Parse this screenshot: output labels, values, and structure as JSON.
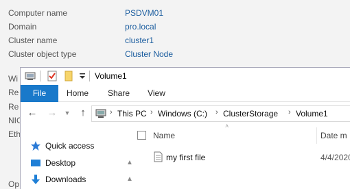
{
  "server_manager": {
    "properties": [
      {
        "label": "Computer name",
        "value": "PSDVM01"
      },
      {
        "label": "Domain",
        "value": "pro.local"
      },
      {
        "label": "Cluster name",
        "value": "cluster1"
      },
      {
        "label": "Cluster object type",
        "value": "Cluster Node"
      }
    ],
    "partial_labels": [
      "Wi",
      "Re",
      "Re",
      "NIC",
      "Eth",
      "Op"
    ]
  },
  "explorer": {
    "title": "Volume1",
    "ribbon_tabs": {
      "file": "File",
      "home": "Home",
      "share": "Share",
      "view": "View"
    },
    "breadcrumb": [
      "This PC",
      "Windows (C:)",
      "ClusterStorage",
      "Volume1"
    ],
    "nav_pane": {
      "quick_access": "Quick access",
      "items": [
        {
          "label": "Desktop",
          "icon": "desktop-icon",
          "pinned": true
        },
        {
          "label": "Downloads",
          "icon": "downloads-icon",
          "pinned": true
        }
      ]
    },
    "columns": {
      "name": "Name",
      "date": "Date m"
    },
    "files": [
      {
        "name": "my first file",
        "date": "4/4/2020"
      }
    ]
  }
}
